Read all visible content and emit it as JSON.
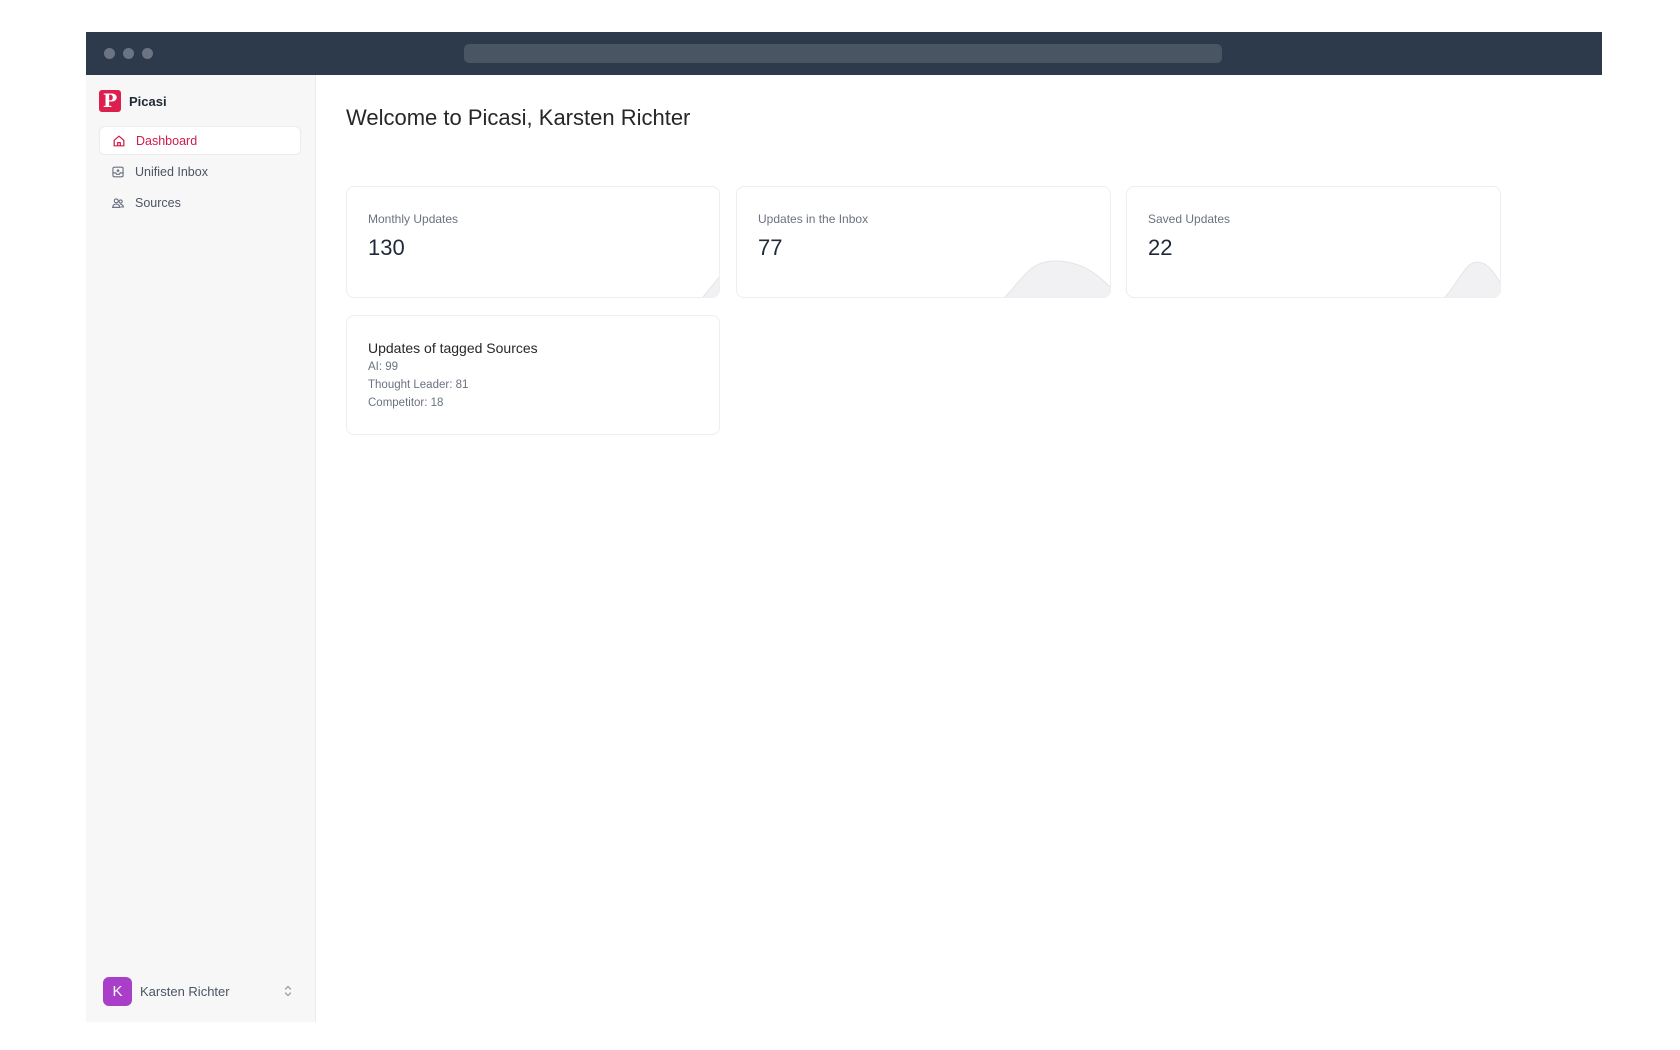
{
  "app": {
    "name": "Picasi",
    "logo_letter": "P",
    "accent": "#dc1f4f"
  },
  "sidebar": {
    "items": [
      {
        "label": "Dashboard",
        "icon": "home-icon",
        "active": true
      },
      {
        "label": "Unified Inbox",
        "icon": "inbox-icon",
        "active": false
      },
      {
        "label": "Sources",
        "icon": "users-icon",
        "active": false
      }
    ]
  },
  "user": {
    "name": "Karsten Richter",
    "initial": "K",
    "avatar_color": "#a93fc9"
  },
  "main": {
    "title": "Welcome to Picasi, Karsten Richter",
    "stats": [
      {
        "label": "Monthly Updates",
        "value": "130"
      },
      {
        "label": "Updates in the Inbox",
        "value": "77"
      },
      {
        "label": "Saved Updates",
        "value": "22"
      }
    ],
    "tags_card": {
      "title": "Updates of tagged Sources",
      "lines": [
        "AI: 99",
        "Thought Leader: 81",
        "Competitor: 18"
      ]
    }
  }
}
